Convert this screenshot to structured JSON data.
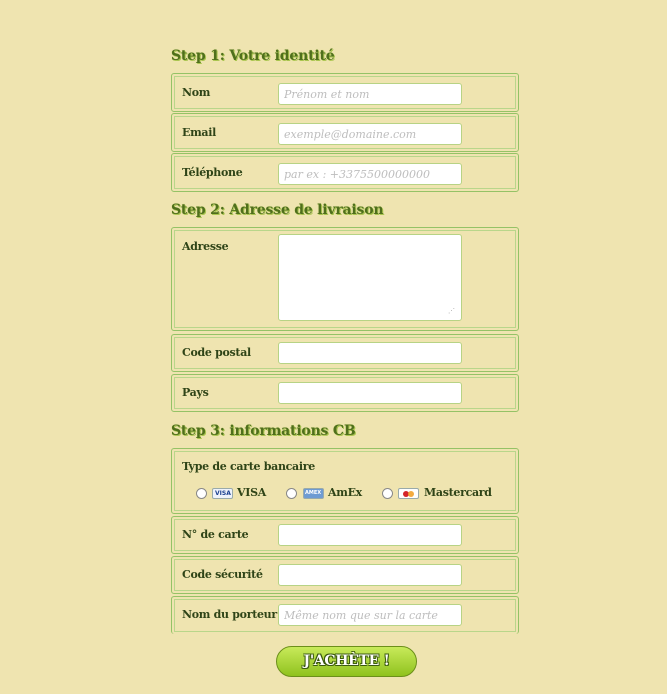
{
  "step1": {
    "title": "Step 1: Votre identité",
    "nom_label": "Nom",
    "nom_placeholder": "Prénom et nom",
    "email_label": "Email",
    "email_placeholder": "exemple@domaine.com",
    "tel_label": "Téléphone",
    "tel_placeholder": "par ex : +3375500000000"
  },
  "step2": {
    "title": "Step 2: Adresse de livraison",
    "adresse_label": "Adresse",
    "cp_label": "Code postal",
    "pays_label": "Pays"
  },
  "step3": {
    "title": "Step 3: informations CB",
    "type_label": "Type de carte bancaire",
    "cards": {
      "visa": "VISA",
      "amex": "AmEx",
      "mastercard": "Mastercard",
      "visa_logo": "VISA",
      "amex_logo": "AMEX"
    },
    "numero_label": "N° de carte",
    "secu_label": "Code sécurité",
    "porteur_label": "Nom du porteur",
    "porteur_placeholder": "Même nom que sur la carte"
  },
  "submit": {
    "label": "J'ACHÈTE !"
  },
  "colors": {
    "background": "#efe4b0",
    "accent": "#8fc21e",
    "heading": "#4f6f1c"
  }
}
